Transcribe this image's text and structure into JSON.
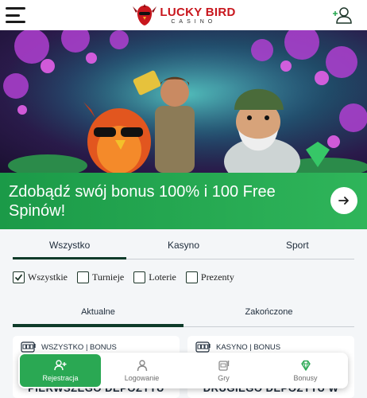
{
  "brand": {
    "name": "LUCKY BIRD",
    "sub": "CASINO",
    "accent": "#c8161d",
    "green": "#2aa853"
  },
  "header": {
    "menu_icon": "hamburger-icon",
    "user_icon": "user-add-icon"
  },
  "promo": {
    "text": "Zdobądź swój bonus 100% i 100 Free Spinów!",
    "button_icon": "arrow-right-icon"
  },
  "tabs": [
    {
      "label": "Wszystko",
      "active": true
    },
    {
      "label": "Kasyno",
      "active": false
    },
    {
      "label": "Sport",
      "active": false
    }
  ],
  "filters": [
    {
      "label": "Wszystkie",
      "checked": true
    },
    {
      "label": "Turnieje",
      "checked": false
    },
    {
      "label": "Loterie",
      "checked": false
    },
    {
      "label": "Prezenty",
      "checked": false
    }
  ],
  "subtabs": [
    {
      "label": "Aktualne",
      "active": true
    },
    {
      "label": "Zakończone",
      "active": false
    }
  ],
  "cards": [
    {
      "tag": "WSZYSTKO | BONUS",
      "title": "PIERWSZEGO DEPOZYTU"
    },
    {
      "tag": "KASYNO | BONUS",
      "title": "DRUGIEGO DEPOZYTU W"
    }
  ],
  "bottom_nav": [
    {
      "label": "Rejestracja",
      "icon": "user-plus-icon",
      "active": true
    },
    {
      "label": "Logowanie",
      "icon": "user-icon",
      "active": false
    },
    {
      "label": "Gry",
      "icon": "slot-machine-icon",
      "active": false
    },
    {
      "label": "Bonusy",
      "icon": "diamond-icon",
      "active": false
    }
  ]
}
